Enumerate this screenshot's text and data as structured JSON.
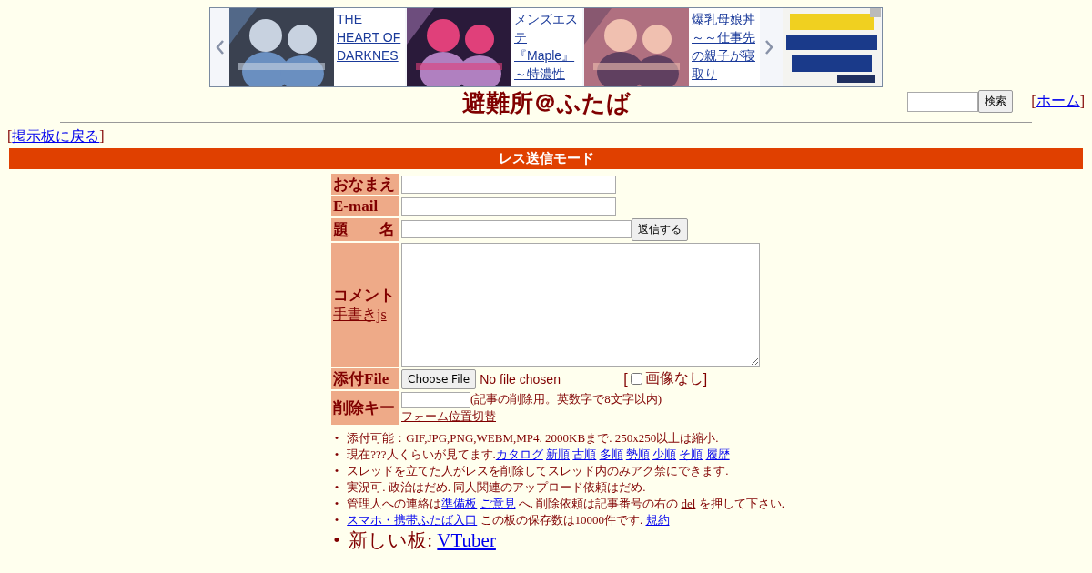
{
  "ads": {
    "items": [
      {
        "title": "THE HEART OF DARKNES"
      },
      {
        "title": "メンズエステ『Maple』～特濃性"
      },
      {
        "title": "爆乳母娘丼～～仕事先の親子が寝取り"
      }
    ]
  },
  "header": {
    "title": "避難所＠ふたば",
    "search": {
      "button": "検索"
    },
    "home_link": {
      "open": "[",
      "text": "ホーム",
      "close": "]"
    }
  },
  "back_link": {
    "open": "[",
    "text": "掲示板に戻る",
    "close": "]"
  },
  "mode_bar": "レス送信モード",
  "form": {
    "rows": [
      {
        "kind": "text",
        "label": "おなまえ"
      },
      {
        "kind": "text",
        "label": "E-mail"
      },
      {
        "kind": "subject",
        "label": "題　　名",
        "button": "返信する"
      },
      {
        "kind": "comment",
        "label": "コメント",
        "link": "手書きjs"
      },
      {
        "kind": "file",
        "label": "添付File",
        "button": "Choose File",
        "status": "No file chosen",
        "checkbox_open": "[",
        "checkbox_label": "画像なし",
        "checkbox_close": "]",
        "checked": false
      },
      {
        "kind": "key",
        "label": "削除キー",
        "note": "(記事の削除用。英数字で8文字以内)",
        "link": "フォーム位置切替"
      }
    ]
  },
  "rules": [
    {
      "bullet": "•",
      "large": false,
      "parts": [
        {
          "kind": "text",
          "text": "添付可能：GIF,JPG,PNG,WEBM,MP4. 2000KBまで. 250x250以上は縮小."
        }
      ]
    },
    {
      "bullet": "•",
      "large": false,
      "parts": [
        {
          "kind": "text",
          "text": "現在???人くらいが見てます."
        },
        {
          "kind": "link",
          "text": "カタログ"
        },
        {
          "kind": "link",
          "text": "新順"
        },
        {
          "kind": "link",
          "text": "古順"
        },
        {
          "kind": "link",
          "text": "多順"
        },
        {
          "kind": "link",
          "text": "勢順"
        },
        {
          "kind": "link",
          "text": "少順"
        },
        {
          "kind": "link",
          "text": "そ順"
        },
        {
          "kind": "link",
          "text": "履歴"
        }
      ]
    },
    {
      "bullet": "•",
      "large": false,
      "parts": [
        {
          "kind": "text",
          "text": "スレッドを立てた人がレスを削除してスレッド内のみアク禁にできます."
        }
      ]
    },
    {
      "bullet": "•",
      "large": false,
      "parts": [
        {
          "kind": "text",
          "text": "実況可. 政治はだめ. 同人関連のアップロード依頼はだめ."
        }
      ]
    },
    {
      "bullet": "•",
      "large": false,
      "parts": [
        {
          "kind": "text",
          "text": "管理人への連絡は"
        },
        {
          "kind": "link",
          "text": "準備板"
        },
        {
          "kind": "link",
          "text": "ご意見"
        },
        {
          "kind": "text",
          "text": "へ. 削除依頼は記事番号の右の"
        },
        {
          "kind": "visited",
          "text": "del"
        },
        {
          "kind": "text",
          "text": "を押して下さい."
        }
      ]
    },
    {
      "bullet": "•",
      "large": false,
      "parts": [
        {
          "kind": "link",
          "text": "スマホ・携帯ふたば入口"
        },
        {
          "kind": "text",
          "text": "この板の保存数は10000件です."
        },
        {
          "kind": "link",
          "text": "規約"
        }
      ]
    },
    {
      "bullet": "•",
      "large": true,
      "parts": [
        {
          "kind": "text",
          "text": "新しい板:"
        },
        {
          "kind": "link",
          "text": "VTuber"
        }
      ]
    }
  ]
}
